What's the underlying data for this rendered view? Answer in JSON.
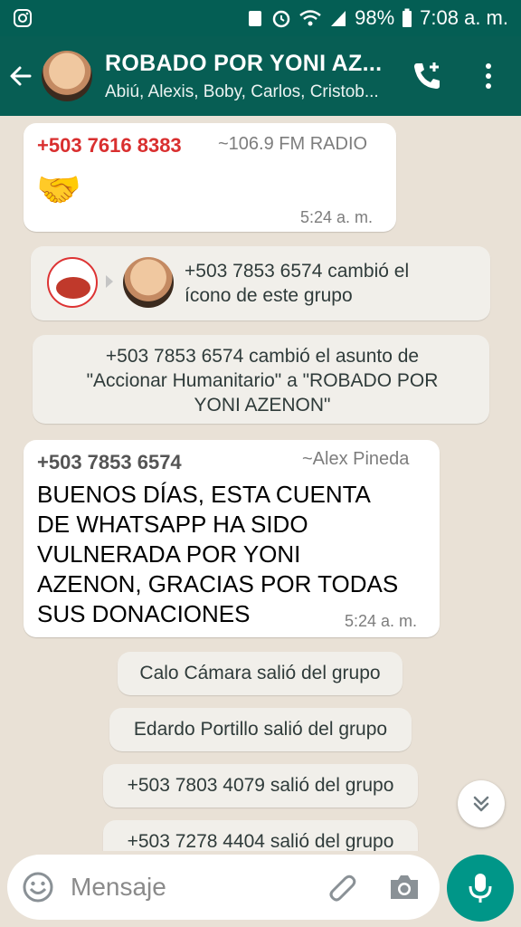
{
  "status": {
    "battery": "98%",
    "time": "7:08 a. m."
  },
  "header": {
    "title": "ROBADO POR YONI AZ...",
    "subtitle": "Abiú, Alexis, Boby, Carlos, Cristob..."
  },
  "messages": {
    "m1": {
      "sender": "+503 7616 8383",
      "name": "~106.9 FM RADIO",
      "emoji": "🤝",
      "time": "5:24 a. m."
    },
    "sys_icon": {
      "text": "+503 7853 6574 cambió el ícono de este grupo"
    },
    "sys_subject": {
      "text": "+503 7853 6574 cambió el asunto de \"Accionar Humanitario\" a \"ROBADO POR YONI AZENON\""
    },
    "m2": {
      "sender": "+503 7853 6574",
      "name": "~Alex Pineda",
      "text": "BUENOS DÍAS, ESTA CUENTA DE WHATSAPP HA SIDO VULNERADA POR YONI AZENON, GRACIAS POR TODAS SUS DONACIONES",
      "time": "5:24 a. m."
    },
    "sys_left1": "Calo Cámara salió del grupo",
    "sys_left2": "Edardo Portillo salió del grupo",
    "sys_left3": "+503 7803 4079 salió del grupo",
    "sys_left4": "+503 7278 4404 salió del grupo"
  },
  "input": {
    "placeholder": "Mensaje"
  },
  "colors": {
    "appbar": "#075e54",
    "sender_red": "#d92f2f",
    "fab": "#009688"
  },
  "icons": [
    "instagram-icon",
    "back-arrow-icon",
    "add-call-icon",
    "more-vert-icon",
    "emoji-icon",
    "attach-icon",
    "camera-icon",
    "mic-icon",
    "double-chevron-down-icon"
  ]
}
